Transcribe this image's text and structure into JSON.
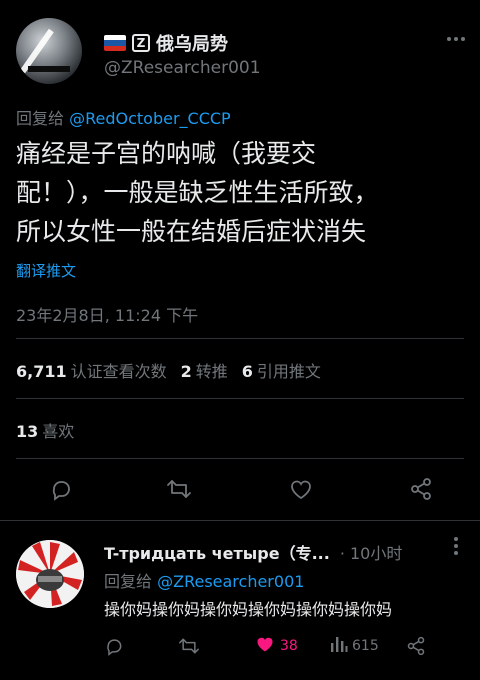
{
  "tweet": {
    "author_name": "俄乌局势",
    "flag_colors": [
      "#ffffff",
      "#1c57a5",
      "#d52b1e"
    ],
    "z_badge": "Z",
    "handle": "@ZResearcher001",
    "more_icon": "more-dots-icon",
    "reply_prefix": "回复给",
    "reply_mention": "@RedOctober_CCCP",
    "body_lines": [
      "痛经是子宫的呐喊（我要交",
      "配！），一般是缺乏性生活所致，",
      "所以女性一般在结婚后症状消失"
    ],
    "translate_label": "翻译推文",
    "timestamp": "23年2月8日, 11:24 下午",
    "views_count": "6,711",
    "views_label": "认证查看次数",
    "retweets_count": "2",
    "retweets_label": "转推",
    "quotes_count": "6",
    "quotes_label": "引用推文",
    "likes_count": "13",
    "likes_label": "喜欢",
    "actions": [
      "reply-icon",
      "retweet-icon",
      "like-icon",
      "share-icon"
    ]
  },
  "reply": {
    "author_name": "T-тридцать четыре（专...",
    "time": "· 10小时",
    "reply_prefix": "回复给",
    "reply_mention": "@ZResearcher001",
    "body": "操你妈操你妈操你妈操你妈操你妈操你妈",
    "likes_count": "38",
    "views_count": "615",
    "like_color": "#f91880"
  },
  "colors": {
    "accent": "#1d9bf0",
    "muted": "#71767b",
    "text": "#e7e9ea",
    "background": "#000000"
  }
}
